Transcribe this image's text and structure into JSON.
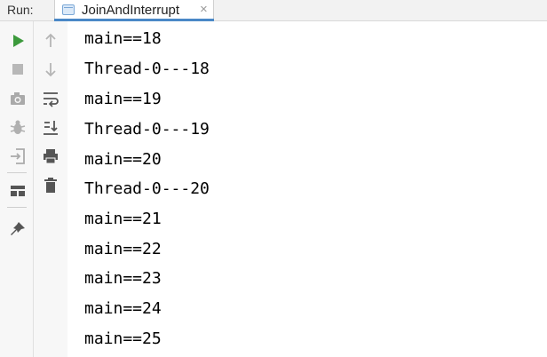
{
  "header": {
    "run_label": "Run:",
    "tab_label": "JoinAndInterrupt",
    "tab_close": "×"
  },
  "colors": {
    "accent": "#4a88c7",
    "run_green": "#3c9a3c",
    "icon_gray": "#9a9a9a"
  },
  "toolbar_left": [
    "run-icon",
    "stop-icon",
    "camera-icon",
    "debug-bug-icon",
    "exit-icon",
    "layout-icon",
    "pin-icon"
  ],
  "toolbar_right": [
    "up-arrow-icon",
    "down-arrow-icon",
    "soft-wrap-icon",
    "scroll-to-end-icon",
    "print-icon",
    "trash-icon"
  ],
  "console": {
    "lines": [
      "main==18",
      "Thread-0---18",
      "main==19",
      "Thread-0---19",
      "main==20",
      "Thread-0---20",
      "main==21",
      "main==22",
      "main==23",
      "main==24",
      "main==25"
    ]
  }
}
